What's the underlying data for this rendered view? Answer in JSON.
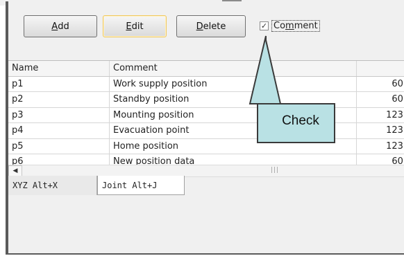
{
  "toolbar": {
    "add_label_rest": "dd",
    "add_label_key": "A",
    "edit_label_key": "E",
    "edit_label_rest": "dit",
    "delete_label_key": "D",
    "delete_label_rest": "elete",
    "comment_checkbox": {
      "pre": "Co",
      "key": "m",
      "post": "ment",
      "checked": true
    }
  },
  "table": {
    "columns": [
      "Name",
      "Comment",
      ""
    ],
    "rows": [
      {
        "name": "p1",
        "comment": "Work supply position",
        "value": "60("
      },
      {
        "name": "p2",
        "comment": "Standby position",
        "value": "60("
      },
      {
        "name": "p3",
        "comment": "Mounting position",
        "value": "123("
      },
      {
        "name": "p4",
        "comment": "Evacuation point",
        "value": "123("
      },
      {
        "name": "p5",
        "comment": "Home position",
        "value": "123("
      },
      {
        "name": "p6",
        "comment": "New position data",
        "value": "60("
      }
    ]
  },
  "tabs": [
    {
      "label": "XYZ  Alt+X"
    },
    {
      "label": "Joint  Alt+J"
    }
  ],
  "callout": {
    "text": "Check",
    "fill": "#b9e1e4",
    "stroke": "#3a3a3a"
  },
  "colors": {
    "window_bg": "#f0f0f0",
    "highlight_border": "#f0c860"
  },
  "icons": {
    "scroll_left": "left-arrow-icon",
    "scroll_grip": "grip-icon",
    "checkmark": "check-icon"
  }
}
